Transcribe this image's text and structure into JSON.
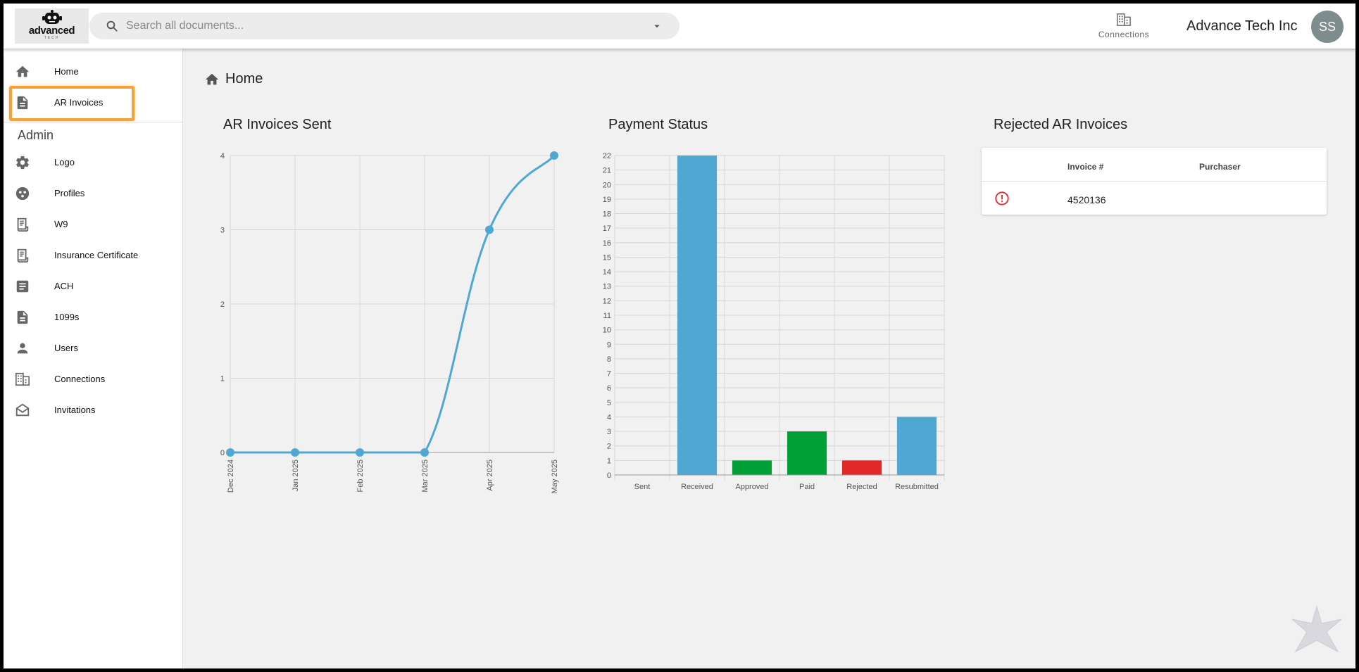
{
  "header": {
    "logo_text": "advanced",
    "logo_sub": "TECH",
    "search_placeholder": "Search all documents...",
    "connections_label": "Connections",
    "company_name": "Advance Tech Inc",
    "avatar_initials": "SS"
  },
  "sidebar": {
    "items": [
      {
        "label": "Home",
        "icon": "home-icon"
      },
      {
        "label": "AR Invoices",
        "icon": "document-icon"
      }
    ],
    "admin_heading": "Admin",
    "admin_items": [
      {
        "label": "Logo",
        "icon": "gear-icon"
      },
      {
        "label": "Profiles",
        "icon": "profiles-icon"
      },
      {
        "label": "W9",
        "icon": "form-icon"
      },
      {
        "label": "Insurance Certificate",
        "icon": "certificate-icon"
      },
      {
        "label": "ACH",
        "icon": "article-icon"
      },
      {
        "label": "1099s",
        "icon": "file-icon"
      },
      {
        "label": "Users",
        "icon": "user-icon"
      },
      {
        "label": "Connections",
        "icon": "building-icon"
      },
      {
        "label": "Invitations",
        "icon": "envelope-icon"
      }
    ]
  },
  "breadcrumb": {
    "label": "Home"
  },
  "cards": {
    "sent_title": "AR Invoices Sent",
    "status_title": "Payment Status",
    "rejected_title": "Rejected AR Invoices"
  },
  "chart_data": [
    {
      "type": "line",
      "title": "AR Invoices Sent",
      "x": [
        "Dec 2024",
        "Jan 2025",
        "Feb 2025",
        "Mar 2025",
        "Apr 2025",
        "May 2025"
      ],
      "values": [
        0,
        0,
        0,
        0,
        3,
        4
      ],
      "ylim": [
        0,
        4
      ],
      "yticks": [
        0,
        1,
        2,
        3,
        4
      ],
      "grid": true,
      "color": "#4fa8d1"
    },
    {
      "type": "bar",
      "title": "Payment Status",
      "categories": [
        "Sent",
        "Received",
        "Approved",
        "Paid",
        "Rejected",
        "Resubmitted"
      ],
      "values": [
        0,
        22,
        1,
        3,
        1,
        4
      ],
      "colors": [
        "#4fa8d1",
        "#4fa8d1",
        "#00a037",
        "#00a037",
        "#e02828",
        "#4fa8d1"
      ],
      "ylim": [
        0,
        22
      ],
      "grid": true
    }
  ],
  "rejected_table": {
    "columns": [
      "Invoice #",
      "Purchaser"
    ],
    "rows": [
      {
        "invoice": "4520136",
        "purchaser": ""
      }
    ]
  },
  "colors": {
    "highlight": "#f5a337",
    "error": "#e02828",
    "accent": "#4fa8d1"
  }
}
